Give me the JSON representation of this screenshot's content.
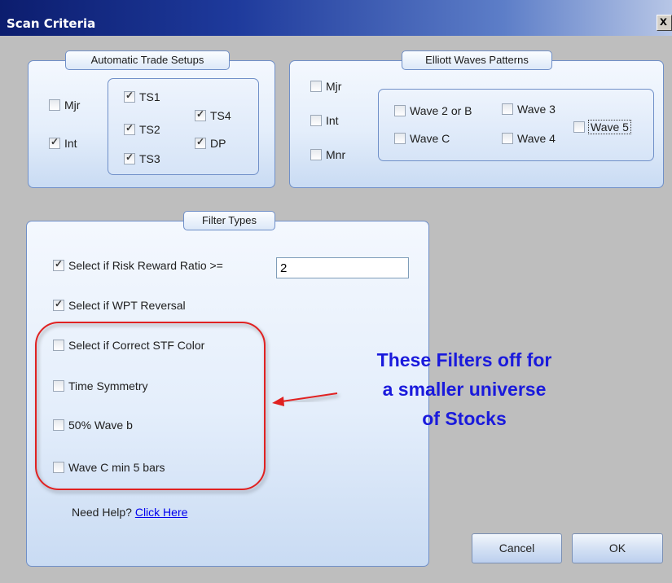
{
  "window": {
    "title": "Scan Criteria",
    "close_glyph": "x"
  },
  "trade_setups": {
    "legend": "Automatic Trade Setups",
    "items": [
      {
        "label": "Mjr",
        "checked": false
      },
      {
        "label": "Int",
        "checked": true
      },
      {
        "label": "TS1",
        "checked": true
      },
      {
        "label": "TS2",
        "checked": true
      },
      {
        "label": "TS3",
        "checked": true
      },
      {
        "label": "TS4",
        "checked": true
      },
      {
        "label": "DP",
        "checked": true
      }
    ]
  },
  "elliott": {
    "legend": "Elliott Waves Patterns",
    "items": [
      {
        "label": "Mjr",
        "checked": false
      },
      {
        "label": "Int",
        "checked": false
      },
      {
        "label": "Mnr",
        "checked": false
      },
      {
        "label": "Wave 2 or B",
        "checked": false
      },
      {
        "label": "Wave 3",
        "checked": false
      },
      {
        "label": "Wave C",
        "checked": false
      },
      {
        "label": "Wave 4",
        "checked": false
      },
      {
        "label": "Wave 5",
        "checked": false
      }
    ]
  },
  "filters": {
    "legend": "Filter Types",
    "items": [
      {
        "label": "Select if Risk Reward Ratio >=",
        "checked": true
      },
      {
        "label": "Select if WPT Reversal",
        "checked": true
      },
      {
        "label": "Select if Correct STF Color",
        "checked": false
      },
      {
        "label": "Time Symmetry",
        "checked": false
      },
      {
        "label": "50% Wave b",
        "checked": false
      },
      {
        "label": "Wave C min 5 bars",
        "checked": false
      }
    ],
    "risk_reward_value": "2",
    "help_text": "Need Help?",
    "help_link": "Click Here"
  },
  "buttons": {
    "cancel": "Cancel",
    "ok": "OK"
  },
  "annotation": {
    "line1": "These Filters off for",
    "line2": "a smaller universe",
    "line3": "of Stocks",
    "text_color": "#1a1adc",
    "circle_color": "#e02020"
  }
}
